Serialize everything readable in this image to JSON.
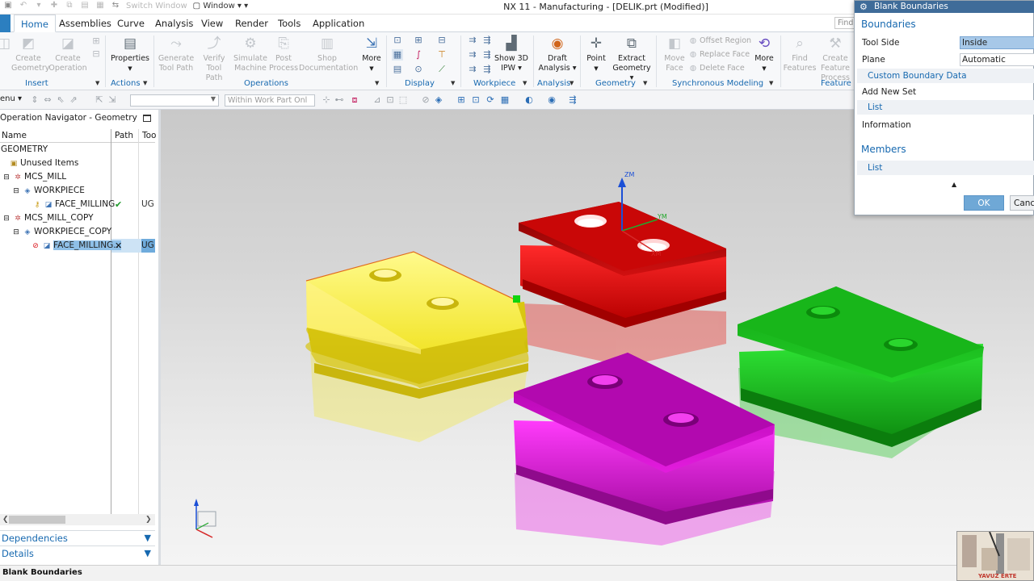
{
  "window": {
    "title": "NX 11 - Manufacturing - [DELIK.prt (Modified)]"
  },
  "quick_access": {
    "switch_window": "Switch Window",
    "window_menu": "Window"
  },
  "tabs": [
    {
      "label": "Home",
      "active": true
    },
    {
      "label": "Assemblies"
    },
    {
      "label": "Curve"
    },
    {
      "label": "Analysis"
    },
    {
      "label": "View"
    },
    {
      "label": "Render"
    },
    {
      "label": "Tools"
    },
    {
      "label": "Application"
    }
  ],
  "find": {
    "placeholder": "Find"
  },
  "ribbon": {
    "create_geometry": "Create Geometry",
    "create_operation": "Create Operation",
    "properties": "Properties",
    "generate_tool_path": "Generate Tool Path",
    "verify_tool_path": "Verify Tool Path",
    "simulate_machine": "Simulate Machine",
    "post_process": "Post Process",
    "shop_documentation": "Shop Documentation",
    "more": "More",
    "show_3d_ipw": "Show 3D IPW",
    "draft_analysis": "Draft Analysis",
    "point": "Point",
    "extract_geometry": "Extract Geometry",
    "move_face": "Move Face",
    "offset_region": "Offset Region",
    "replace_face": "Replace Face",
    "delete_face": "Delete Face",
    "more2": "More",
    "find_features": "Find Features",
    "create_feature_process": "Create Feature Process",
    "groups": {
      "insert": "Insert",
      "actions": "Actions",
      "operations": "Operations",
      "display": "Display",
      "workpiece": "Workpiece",
      "analysis": "Analysis",
      "geometry": "Geometry",
      "synchronous_modeling": "Synchronous Modeling",
      "feature": "Feature"
    }
  },
  "selection_bar": {
    "menu": "enu",
    "scope": "Within Work Part Onl"
  },
  "navigator": {
    "title": "Operation Navigator - Geometry",
    "columns": {
      "name": "Name",
      "path": "Path",
      "tool": "Too"
    },
    "rows": [
      {
        "name": "GEOMETRY"
      },
      {
        "name": "Unused Items"
      },
      {
        "name": "MCS_MILL"
      },
      {
        "name": "WORKPIECE"
      },
      {
        "name": "FACE_MILLING",
        "path": "✔",
        "tool": "UG"
      },
      {
        "name": "MCS_MILL_COPY"
      },
      {
        "name": "WORKPIECE_COPY"
      },
      {
        "name": "FACE_MILLING...",
        "path": "✕",
        "tool": "UG"
      }
    ],
    "panels": {
      "dependencies": "Dependencies",
      "details": "Details"
    }
  },
  "viewport": {
    "axes": {
      "zm": "ZM",
      "ym": "YM",
      "xm": "XM"
    },
    "part_colors": {
      "yellow": "#f4e934",
      "red": "#e8170f",
      "green": "#18c21a",
      "magenta": "#e515e0"
    }
  },
  "dialog": {
    "title": "Blank Boundaries",
    "boundaries_section": "Boundaries",
    "tool_side_label": "Tool Side",
    "tool_side_value": "Inside",
    "plane_label": "Plane",
    "plane_value": "Automatic",
    "custom_boundary_data": "Custom Boundary Data",
    "add_new_set": "Add New Set",
    "list1": "List",
    "information": "Information",
    "members_section": "Members",
    "list2": "List",
    "ok": "OK",
    "cancel": "Canc"
  },
  "status": {
    "text": "Blank Boundaries"
  },
  "watermark": {
    "text": "YAVUZ ERTE"
  },
  "colors": {
    "accent": "#1769b0",
    "dialog_title": "#3f6c99",
    "selection": "#8fc0e8"
  }
}
